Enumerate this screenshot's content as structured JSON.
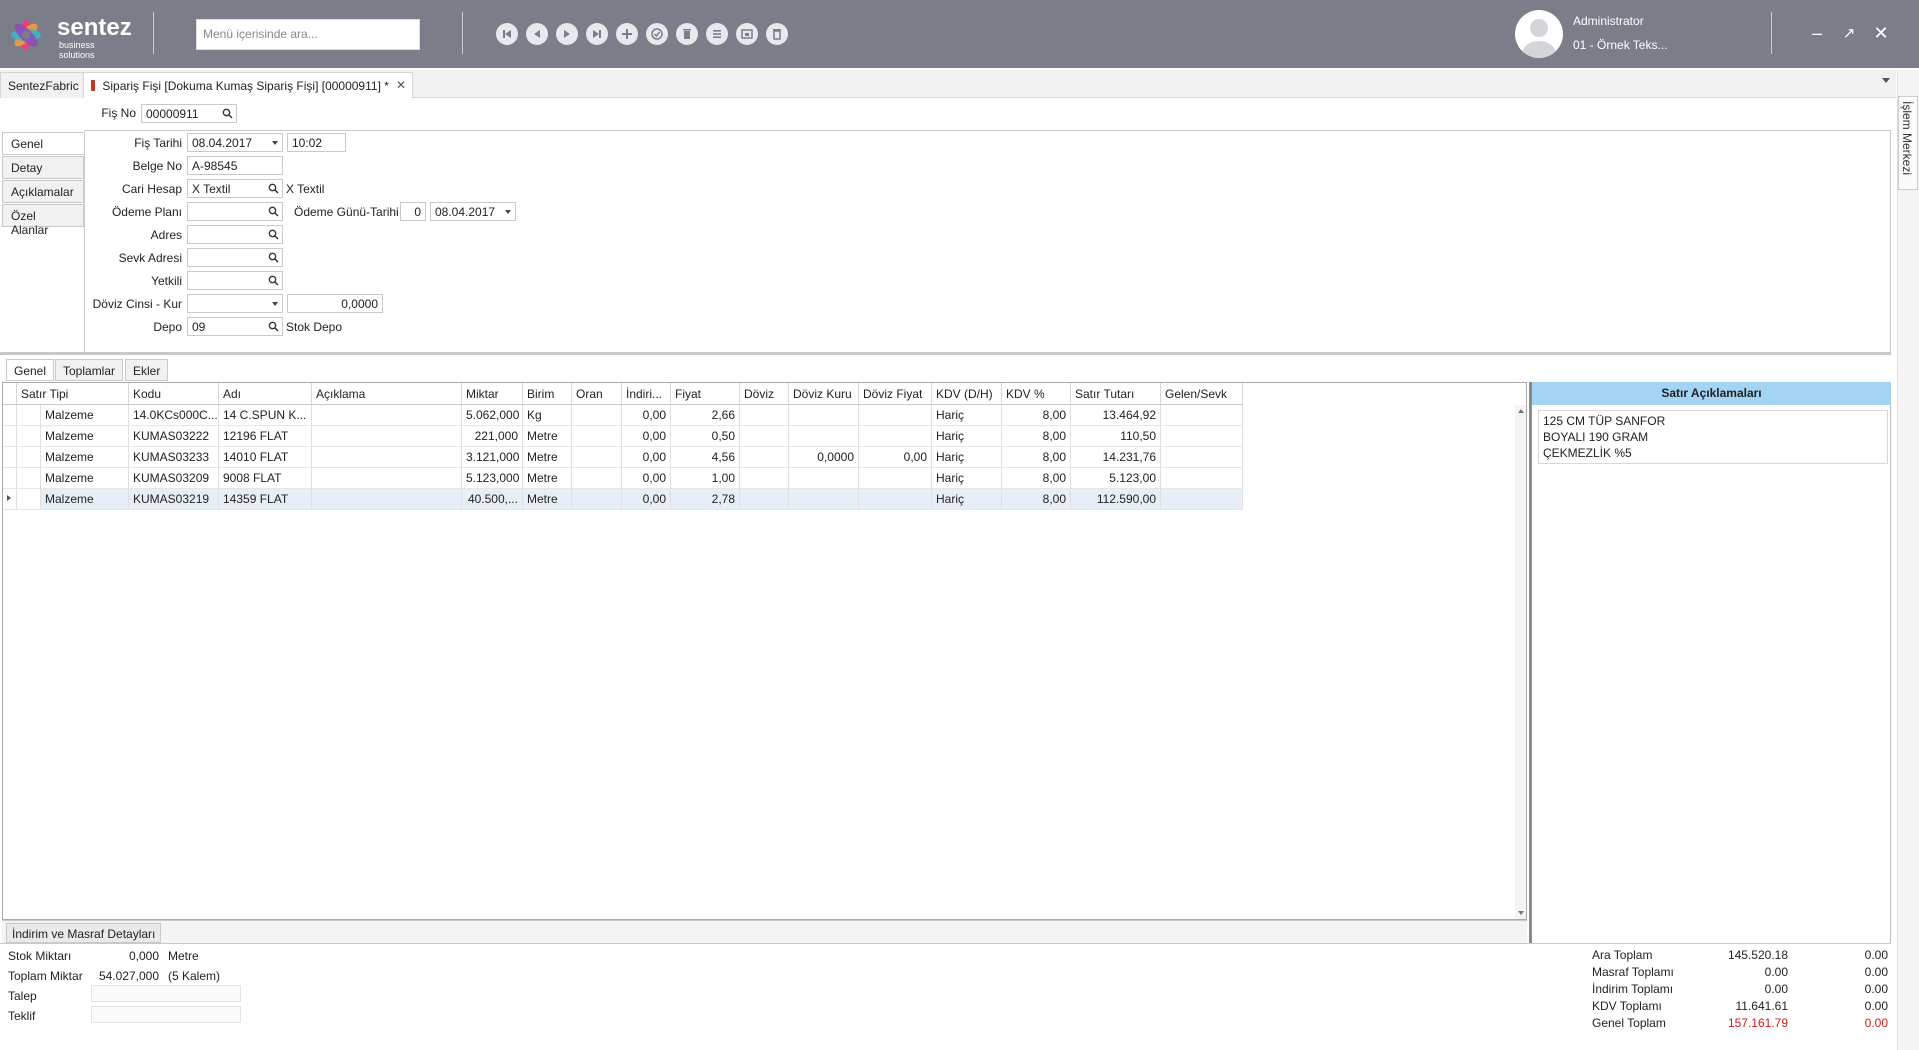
{
  "header": {
    "logo_name": "sentez",
    "logo_tagline": "business solutions",
    "search_placeholder": "Menü içerisinde ara...",
    "user_name": "Administrator",
    "company": "01 - Örnek Teks...",
    "nav_icons": [
      "first-record-icon",
      "previous-record-icon",
      "next-record-icon",
      "last-record-icon",
      "add-icon",
      "approve-icon",
      "delete-icon",
      "list-icon",
      "print-preview-icon",
      "trash-icon"
    ]
  },
  "tabs": {
    "home": "SentezFabric",
    "document": "Sipariş Fişi [Dokuma Kumaş Sipariş Fişi]  [00000911]  *",
    "side_panel": "İşlem Merkezi"
  },
  "form": {
    "fis_no_label": "Fiş No",
    "fis_no": "00000911",
    "left_tabs": [
      "Genel",
      "Detay",
      "Açıklamalar",
      "Özel Alanlar"
    ],
    "fis_tarihi_label": "Fiş Tarihi",
    "fis_tarihi": "08.04.2017",
    "saat": "10:02",
    "belge_no_label": "Belge No",
    "belge_no": "A-98545",
    "cari_hesap_label": "Cari Hesap",
    "cari_hesap": "X Textil",
    "cari_hesap_name": "X Textil",
    "odeme_plani_label": "Ödeme Planı",
    "odeme_plani": "",
    "odeme_gunu_label": "Ödeme Günü-Tarihi",
    "odeme_gunu": "0",
    "odeme_tarihi": "08.04.2017",
    "adres_label": "Adres",
    "sevk_adresi_label": "Sevk Adresi",
    "yetkili_label": "Yetkili",
    "doviz_label": "Döviz Cinsi - Kur",
    "doviz_kur": "0,0000",
    "depo_label": "Depo",
    "depo": "09",
    "depo_name": "Stok Depo"
  },
  "grid": {
    "tabs": [
      "Genel",
      "Toplamlar",
      "Ekler"
    ],
    "columns": [
      "Satır Tipi",
      "Kodu",
      "Adı",
      "Açıklama",
      "Miktar",
      "Birim",
      "Oran",
      "İndiri...",
      "Fiyat",
      "Döviz",
      "Döviz Kuru",
      "Döviz Fiyat",
      "KDV (D/H)",
      "KDV %",
      "Satır Tutarı",
      "Gelen/Sevk"
    ],
    "rows": [
      [
        "Malzeme",
        "14.0KCs000C...",
        "14 C.SPUN K...",
        "",
        "5.062,000",
        "Kg",
        "",
        "0,00",
        "2,66",
        "",
        "",
        "",
        "Hariç",
        "8,00",
        "13.464,92",
        ""
      ],
      [
        "Malzeme",
        "KUMAS03222",
        "12196 FLAT",
        "",
        "221,000",
        "Metre",
        "",
        "0,00",
        "0,50",
        "",
        "",
        "",
        "Hariç",
        "8,00",
        "110,50",
        ""
      ],
      [
        "Malzeme",
        "KUMAS03233",
        "14010 FLAT",
        "",
        "3.121,000",
        "Metre",
        "",
        "0,00",
        "4,56",
        "",
        "0,0000",
        "0,00",
        "Hariç",
        "8,00",
        "14.231,76",
        ""
      ],
      [
        "Malzeme",
        "KUMAS03209",
        "9008 FLAT",
        "",
        "5.123,000",
        "Metre",
        "",
        "0,00",
        "1,00",
        "",
        "",
        "",
        "Hariç",
        "8,00",
        "5.123,00",
        ""
      ],
      [
        "Malzeme",
        "KUMAS03219",
        "14359 FLAT",
        "",
        "40.500,...",
        "Metre",
        "",
        "0,00",
        "2,78",
        "",
        "",
        "",
        "Hariç",
        "8,00",
        "112.590,00",
        ""
      ]
    ],
    "discount_button": "İndirim ve Masraf Detayları"
  },
  "notes": {
    "title": "Satır Açıklamaları",
    "line1": "125 CM TÜP SANFOR",
    "line2": "BOYALI 190 GRAM",
    "line3": "ÇEKMEZLİK %5"
  },
  "footer": {
    "stok_miktari_label": "Stok Miktarı",
    "stok_miktari": "0,000",
    "stok_birim": "Metre",
    "toplam_miktar_label": "Toplam Miktar",
    "toplam_miktar": "54.027,000",
    "kalem": "(5 Kalem)",
    "talep_label": "Talep",
    "teklif_label": "Teklif"
  },
  "totals": {
    "ara_toplam_label": "Ara Toplam",
    "ara_toplam": "145.520.18",
    "ara_toplam_doviz": "0.00",
    "masraf_label": "Masraf Toplamı",
    "masraf": "0.00",
    "masraf_doviz": "0.00",
    "indirim_label": "İndirim Toplamı",
    "indirim": "0.00",
    "indirim_doviz": "0.00",
    "kdv_label": "KDV Toplamı",
    "kdv": "11.641.61",
    "kdv_doviz": "0.00",
    "genel_label": "Genel Toplam",
    "genel": "157.161.79",
    "genel_doviz": "0.00"
  },
  "colors": {
    "topbar": "#7b7e88",
    "notes_header": "#a3d4f4",
    "total_red": "#d01b1b"
  }
}
